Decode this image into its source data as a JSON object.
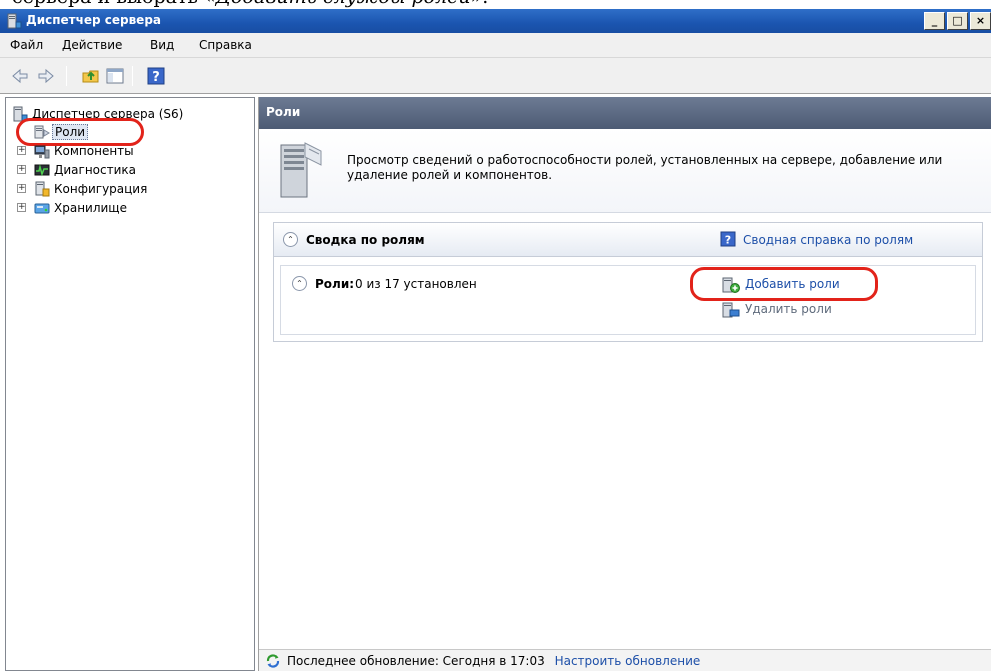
{
  "caption": {
    "prefix": "сервера и выбрать «",
    "italic": "Добавить службы ролей",
    "suffix": "»."
  },
  "window": {
    "title": "Диспетчер сервера",
    "min": "_",
    "max": "□",
    "close": "×"
  },
  "menu": {
    "file": "Файл",
    "action": "Действие",
    "view": "Вид",
    "help": "Справка"
  },
  "tree": {
    "root": "Диспетчер сервера (S6)",
    "roles": "Роли",
    "components": "Компоненты",
    "diagnostics": "Диагностика",
    "configuration": "Конфигурация",
    "storage": "Хранилище"
  },
  "main": {
    "header": "Роли",
    "intro_text": "Просмотр сведений о работоспособности ролей, установленных на сервере, добавление или удаление ролей и компонентов.",
    "summary_title": "Сводка по ролям",
    "summary_help_link": "Сводная справка по ролям",
    "roles_label": "Роли:",
    "roles_status": "0 из 17 установлен",
    "add_roles": "Добавить роли",
    "remove_roles": "Удалить роли"
  },
  "status": {
    "last_update": "Последнее обновление: Сегодня в 17:03",
    "configure_update": "Настроить обновление"
  },
  "colors": {
    "highlight_circle": "#e2231a",
    "link": "#1d4fa8",
    "titlebar": "#1b55b0",
    "pane_header": "#5a6882"
  }
}
